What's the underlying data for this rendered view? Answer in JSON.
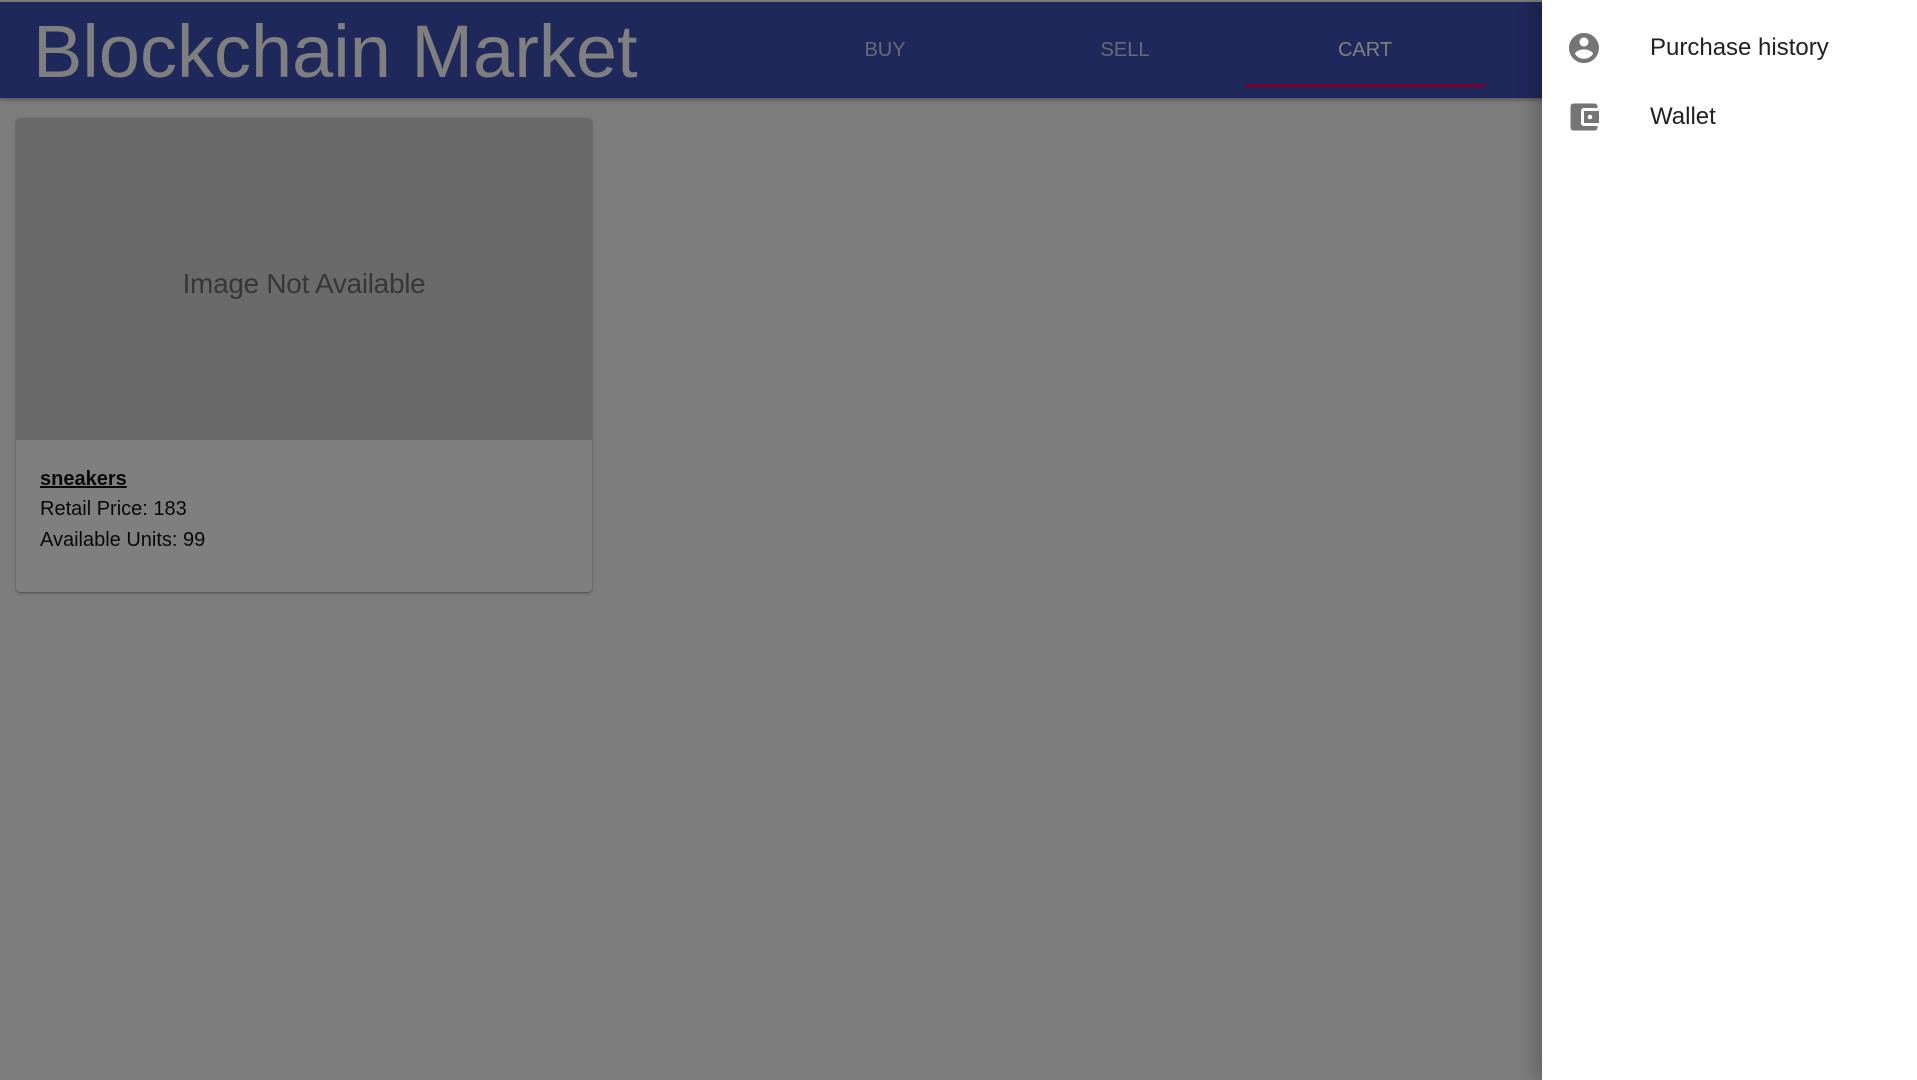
{
  "app": {
    "title": "Blockchain Market"
  },
  "tabs": [
    {
      "label": "BUY",
      "active": false
    },
    {
      "label": "SELL",
      "active": false
    },
    {
      "label": "CART",
      "active": true
    }
  ],
  "product_card": {
    "image_placeholder": "Image Not Available",
    "name": "sneakers",
    "price_line": "Retail Price: 183",
    "units_line": "Available Units: 99"
  },
  "drawer": {
    "items": [
      {
        "label": "Purchase history",
        "icon": "account-circle-icon"
      },
      {
        "label": "Wallet",
        "icon": "wallet-icon"
      }
    ]
  },
  "colors": {
    "appbar": "#3f51b5",
    "tab_indicator": "#f50057",
    "backdrop": "rgba(0,0,0,0.5)",
    "drawer_bg": "#ffffff",
    "icon": "#757575"
  }
}
